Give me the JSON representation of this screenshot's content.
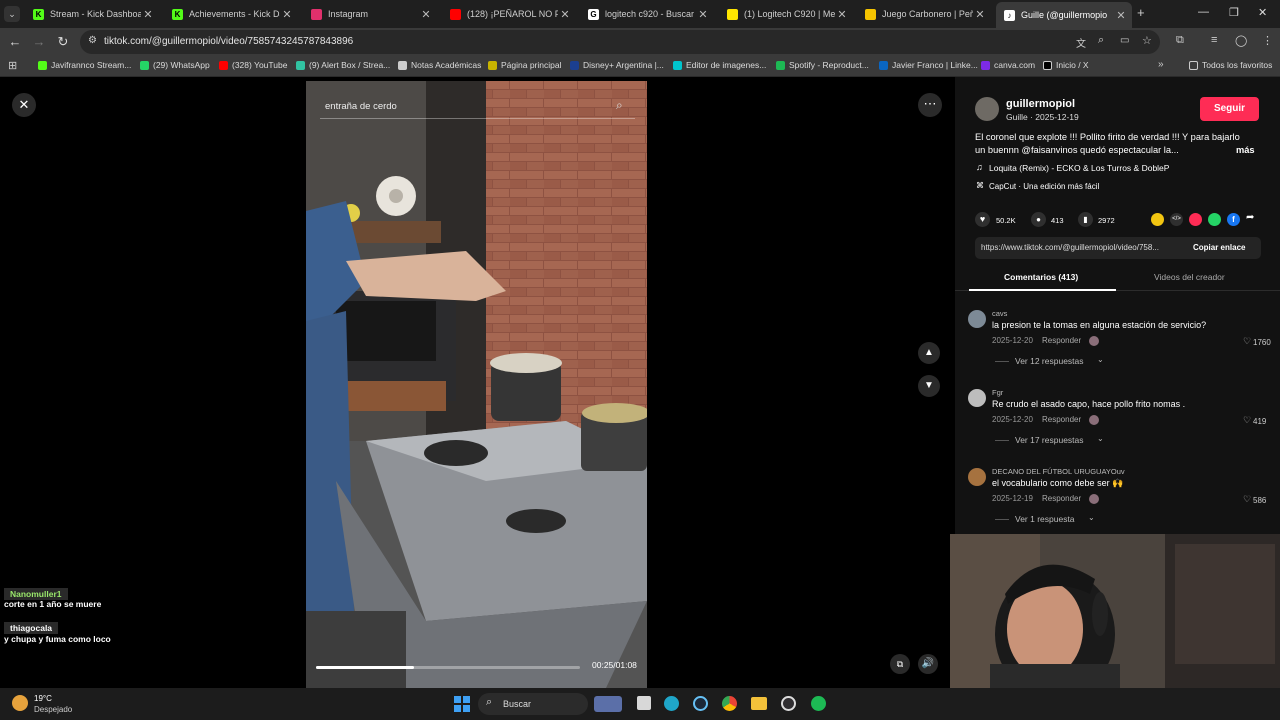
{
  "tabs": [
    {
      "title": "Stream - Kick Dashboard",
      "fav_color": "#53fc18",
      "fav_char": "K"
    },
    {
      "title": "Achievements - Kick Dash",
      "fav_color": "#53fc18",
      "fav_char": "K"
    },
    {
      "title": "Instagram",
      "fav_color": "#e1306c",
      "fav_char": ""
    },
    {
      "title": "(128) ¡PEÑAROL NO PUDO",
      "fav_color": "#ff0000",
      "fav_char": ""
    },
    {
      "title": "logitech c920 - Buscar co",
      "fav_color": "#ffffff",
      "fav_char": "G"
    },
    {
      "title": "(1) Logitech C920 | Merca",
      "fav_color": "#ffe600",
      "fav_char": ""
    },
    {
      "title": "Juego Carbonero | Peñaro",
      "fav_color": "#f5c400",
      "fav_char": ""
    },
    {
      "title": "Guille (@guillermopio",
      "fav_color": "#ffffff",
      "fav_char": "♪"
    }
  ],
  "url": "tiktok.com/@guillermopiol/video/7585743245787843896",
  "bookmarks": [
    {
      "label": "Javifrannco Stream...",
      "color": "#53fc18"
    },
    {
      "label": "(29) WhatsApp",
      "color": "#25d366"
    },
    {
      "label": "(328) YouTube",
      "color": "#ff0000"
    },
    {
      "label": "(9) Alert Box / Strea...",
      "color": "#31c3a2"
    },
    {
      "label": "Notas Académicas",
      "color": "#cccccc"
    },
    {
      "label": "Página principal",
      "color": "#c8b400"
    },
    {
      "label": "Disney+ Argentina |...",
      "color": "#1b3f8f"
    },
    {
      "label": "Editor de imagenes...",
      "color": "#00c4cc"
    },
    {
      "label": "Spotify - Reproduct...",
      "color": "#1db954"
    },
    {
      "label": "Javier Franco | Linke...",
      "color": "#0a66c2"
    },
    {
      "label": "canva.com",
      "color": "#7d2ae8"
    },
    {
      "label": "Inicio / X",
      "color": "#000000"
    }
  ],
  "bookmarks_all": "Todos los favoritos",
  "video": {
    "search_text": "entraña de cerdo",
    "time": "00:25/01:08",
    "progress": 0.37
  },
  "author": {
    "username": "guillermopiol",
    "display": "Guille · 2025-12-19",
    "follow_label": "Seguir"
  },
  "description": {
    "line1": "El coronel que explote !!! Pollito firito de verdad !!! Y para bajarlo",
    "line2": "un buennn @faisanvinos quedó espectacular la...",
    "more": "más",
    "music": "Loquita (Remix) - ECKO & Los Turros & DobleP",
    "capcut": "CapCut · Una edición más fácil"
  },
  "stats": {
    "likes": "50.2K",
    "comments": "413",
    "saves": "2972"
  },
  "share": {
    "link": "https://www.tiktok.com/@guillermopiol/video/758...",
    "copy_label": "Copiar enlace",
    "colors": [
      "#f2c511",
      "#2f2f2f",
      "#fe2c55",
      "#25d366",
      "#1877f2"
    ]
  },
  "panel_tabs": {
    "comments": "Comentarios (413)",
    "creator": "Videos del creador"
  },
  "comments": [
    {
      "user": "cavs",
      "text": "la presion te la tomas en alguna estación de servicio?",
      "date": "2025-12-20",
      "reply": "Responder",
      "likes": "1760",
      "replies": "Ver 12 respuestas"
    },
    {
      "user": "Fgr",
      "text": "Re crudo el asado capo, hace pollo frito nomas .",
      "date": "2025-12-20",
      "reply": "Responder",
      "likes": "419",
      "replies": "Ver 17 respuestas"
    },
    {
      "user": "DECANO DEL FÚTBOL URUGUAYOuv",
      "text": "el vocabulario como debe ser 🙌",
      "date": "2025-12-19",
      "reply": "Responder",
      "likes": "586",
      "replies": "Ver 1 respuesta"
    }
  ],
  "chat": [
    {
      "user": "Nanomuller1",
      "msg": "corte en 1 año se muere",
      "color": "#9ae86b"
    },
    {
      "user": "thiagocala",
      "msg": "y chupa y fuma como loco",
      "color": "#ffffff"
    }
  ],
  "taskbar": {
    "temp": "19°C",
    "weather": "Despejado",
    "search": "Buscar"
  }
}
